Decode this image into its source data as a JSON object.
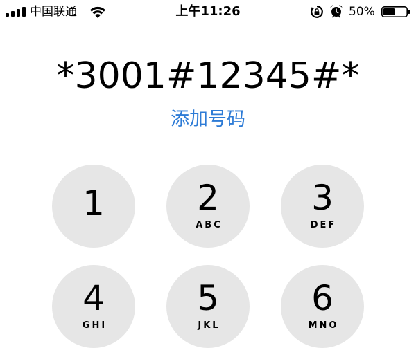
{
  "status_bar": {
    "carrier": "中国联通",
    "time": "上午11:26",
    "battery_percent": "50%",
    "battery_level": 0.5,
    "icons": {
      "signal": "cellular-signal-icon",
      "wifi": "wifi-icon",
      "rotation_lock": "rotation-lock-icon",
      "alarm": "alarm-clock-icon",
      "battery": "battery-icon"
    }
  },
  "dialer": {
    "number": "*3001#12345#*",
    "add_number_label": "添加号码"
  },
  "keypad": {
    "keys": [
      {
        "digit": "1",
        "letters": ""
      },
      {
        "digit": "2",
        "letters": "ABC"
      },
      {
        "digit": "3",
        "letters": "DEF"
      },
      {
        "digit": "4",
        "letters": "GHI"
      },
      {
        "digit": "5",
        "letters": "JKL"
      },
      {
        "digit": "6",
        "letters": "MNO"
      }
    ]
  },
  "colors": {
    "accent": "#2d7bd6",
    "key_background": "#e6e6e6",
    "text": "#000000",
    "background": "#ffffff"
  }
}
